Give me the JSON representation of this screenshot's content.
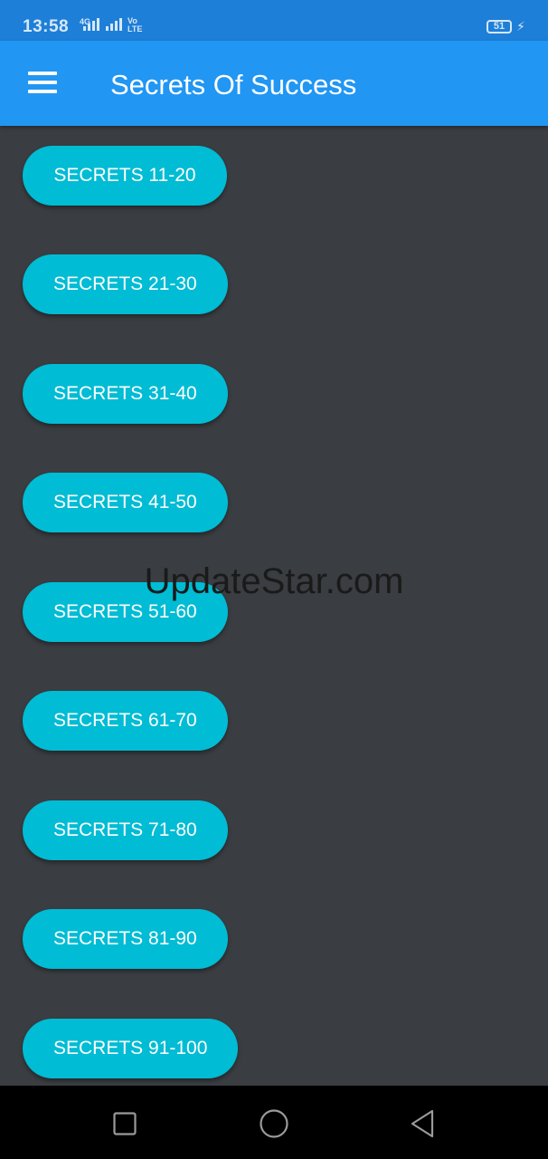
{
  "status_bar": {
    "time": "13:58",
    "network_tag_1": "4G",
    "network_tag_2": "Vo LTE",
    "battery_level": "51"
  },
  "app_bar": {
    "menu_icon": "hamburger-menu-icon",
    "title": "Secrets Of Success"
  },
  "secret_buttons": [
    {
      "label": "SECRETS 11-20"
    },
    {
      "label": "SECRETS 21-30"
    },
    {
      "label": "SECRETS 31-40"
    },
    {
      "label": "SECRETS 41-50"
    },
    {
      "label": "SECRETS 51-60"
    },
    {
      "label": "SECRETS 61-70"
    },
    {
      "label": "SECRETS 71-80"
    },
    {
      "label": "SECRETS 81-90"
    },
    {
      "label": "SECRETS 91-100"
    }
  ],
  "watermark": "UpdateStar.com",
  "nav_bar": {
    "recents_icon": "square-recents-icon",
    "home_icon": "circle-home-icon",
    "back_icon": "triangle-back-icon"
  },
  "colors": {
    "status_bar": "#1e7fd8",
    "app_bar": "#2196f3",
    "background": "#3a3d41",
    "button": "#00bcd4",
    "button_text": "#ffffff",
    "nav_bar": "#000000"
  }
}
